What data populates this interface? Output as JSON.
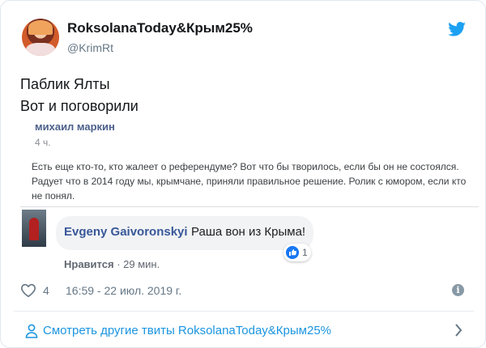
{
  "author": {
    "display_name": "RoksolanaToday&Крым25%",
    "handle": "@KrimRt"
  },
  "tweet": {
    "line1": "Паблик Ялты",
    "line2": "Вот и поговорили"
  },
  "embedded_post": {
    "author": "михаил маркин",
    "time": "4 ч.",
    "text": "Есть еще кто-то, кто жалеет о референдуме? Вот что бы творилось, если бы он не состоялся. Радует что в 2014 году мы, крымчане, приняли правильное решение. Ролик с юмором, если кто не понял."
  },
  "comment": {
    "author": "Evgeny Gaivoronskyi",
    "text": "Раша вон из Крыма!",
    "reactions": "1",
    "like_label": "Нравится",
    "separator": "·",
    "age": "29 мин."
  },
  "footer": {
    "likes": "4",
    "timestamp": "16:59 - 22 июл. 2019 г.",
    "info_glyph": "i"
  },
  "more_tweets": {
    "label": "Смотреть другие твиты RoksolanaToday&Крым25%"
  },
  "colors": {
    "twitter_blue": "#1da1f2",
    "link_blue": "#1b95e0",
    "fb_blue": "#1877f2",
    "fb_name": "#385898"
  },
  "icons": {
    "logo": "twitter-bird-icon",
    "like": "heart-icon",
    "info": "info-icon",
    "profile": "person-icon",
    "next": "chevron-right-icon",
    "reaction": "thumbs-up-icon"
  }
}
